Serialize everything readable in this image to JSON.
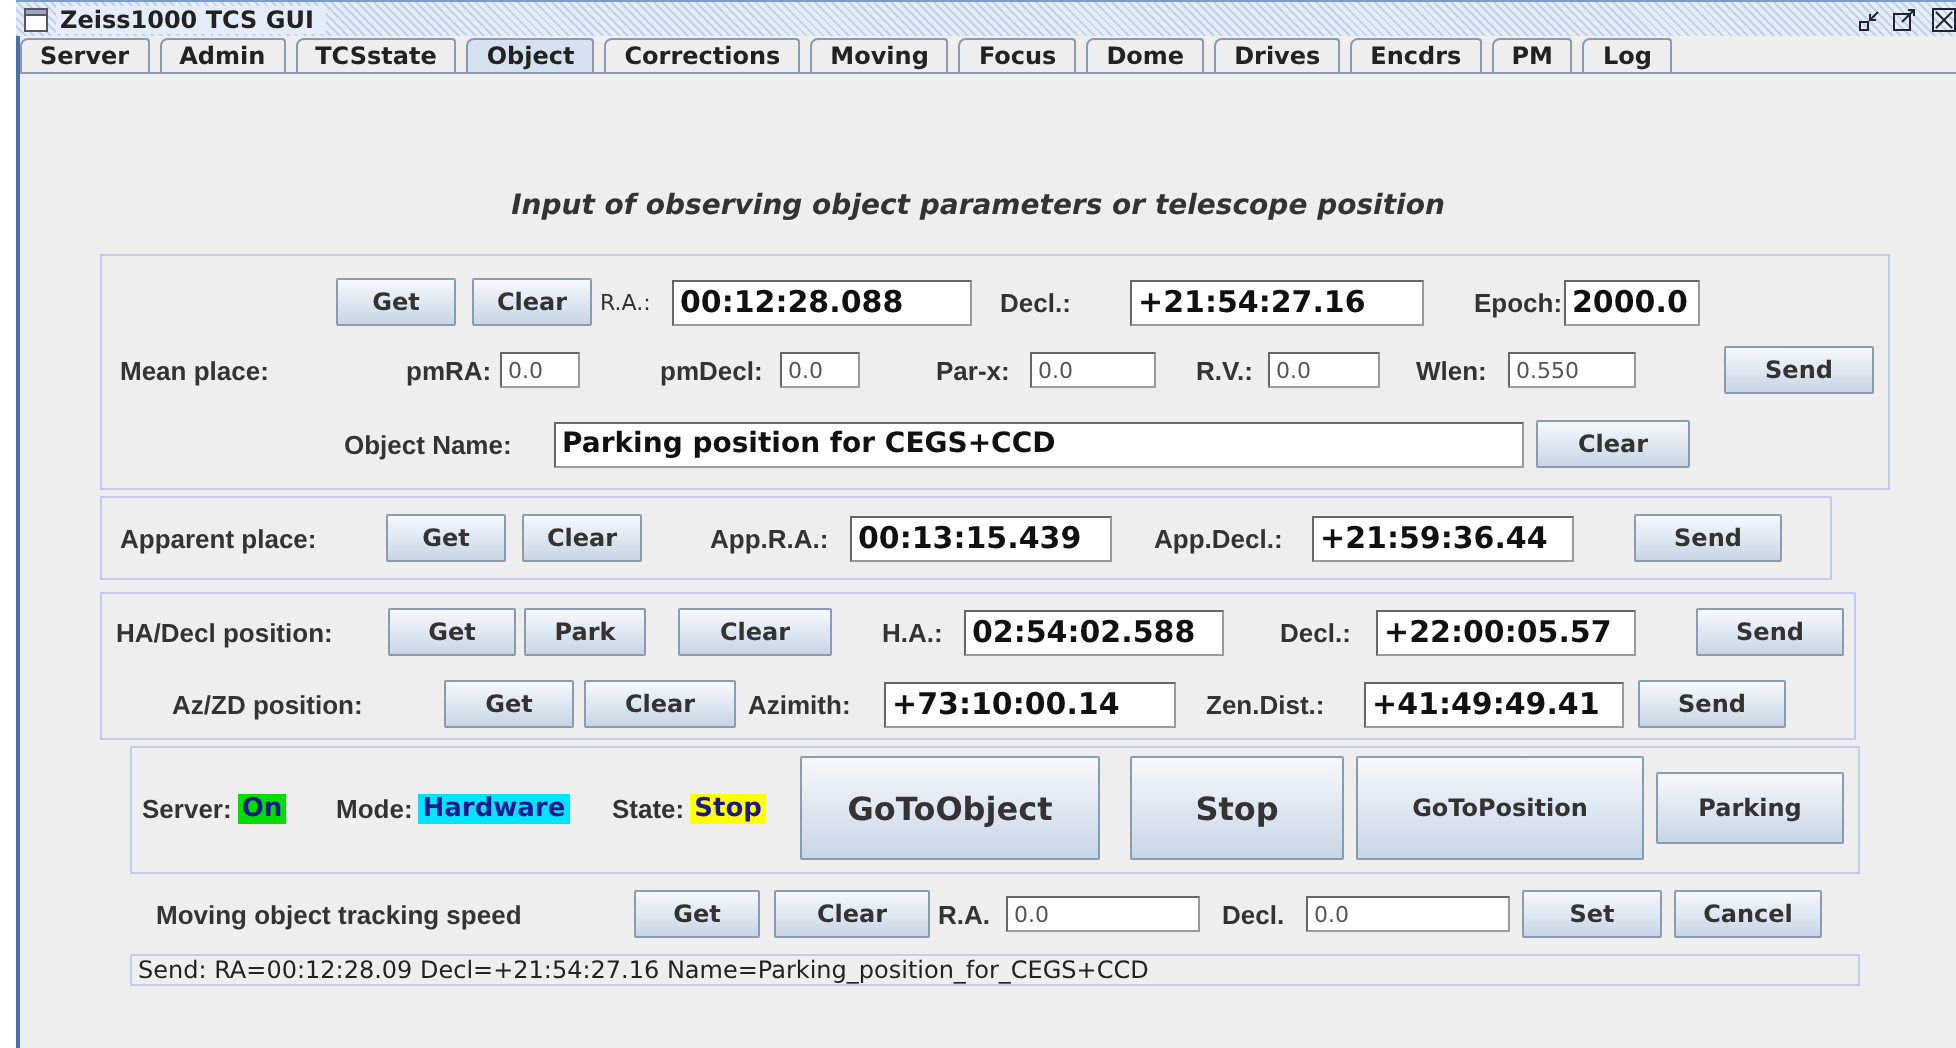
{
  "window": {
    "title": "Zeiss1000 TCS GUI"
  },
  "tabs": [
    {
      "label": "Server",
      "selected": false
    },
    {
      "label": "Admin",
      "selected": false
    },
    {
      "label": "TCSstate",
      "selected": false
    },
    {
      "label": "Object",
      "selected": true
    },
    {
      "label": "Corrections",
      "selected": false
    },
    {
      "label": "Moving",
      "selected": false
    },
    {
      "label": "Focus",
      "selected": false
    },
    {
      "label": "Dome",
      "selected": false
    },
    {
      "label": "Drives",
      "selected": false
    },
    {
      "label": "Encdrs",
      "selected": false
    },
    {
      "label": "PM",
      "selected": false
    },
    {
      "label": "Log",
      "selected": false
    }
  ],
  "heading": "Input of observing object parameters or telescope position",
  "panels": [
    {
      "rows": [
        {
          "items": [
            {
              "kind": "button",
              "text": "Get"
            },
            {
              "kind": "button",
              "text": "Clear"
            },
            {
              "kind": "label",
              "text": "R.A.:"
            },
            {
              "kind": "field",
              "value": "00:12:28.088"
            },
            {
              "kind": "label",
              "text": "Decl.:"
            },
            {
              "kind": "field",
              "value": "+21:54:27.16"
            },
            {
              "kind": "label",
              "text": "Epoch:"
            },
            {
              "kind": "field",
              "value": "2000.0"
            }
          ]
        },
        {
          "items": [
            {
              "kind": "label",
              "text": "Mean place:"
            },
            {
              "kind": "label",
              "text": "pmRA:"
            },
            {
              "kind": "field",
              "value": "0.0"
            },
            {
              "kind": "label",
              "text": "pmDecl:"
            },
            {
              "kind": "field",
              "value": "0.0"
            },
            {
              "kind": "label",
              "text": "Par-x:"
            },
            {
              "kind": "field",
              "value": "0.0"
            },
            {
              "kind": "label",
              "text": "R.V.:"
            },
            {
              "kind": "field",
              "value": "0.0"
            },
            {
              "kind": "label",
              "text": "Wlen:"
            },
            {
              "kind": "field",
              "value": "0.550"
            },
            {
              "kind": "button",
              "text": "Send"
            }
          ]
        },
        {
          "items": [
            {
              "kind": "label",
              "text": "Object Name:"
            },
            {
              "kind": "field",
              "value": "Parking position for CEGS+CCD"
            },
            {
              "kind": "button",
              "text": "Clear"
            }
          ]
        }
      ]
    },
    {
      "rows": [
        {
          "items": [
            {
              "kind": "label",
              "text": "Apparent place:"
            },
            {
              "kind": "button",
              "text": "Get"
            },
            {
              "kind": "button",
              "text": "Clear"
            },
            {
              "kind": "label",
              "text": "App.R.A.:"
            },
            {
              "kind": "field",
              "value": "00:13:15.439"
            },
            {
              "kind": "label",
              "text": "App.Decl.:"
            },
            {
              "kind": "field",
              "value": "+21:59:36.44"
            },
            {
              "kind": "button",
              "text": "Send"
            }
          ]
        }
      ]
    },
    {
      "rows": [
        {
          "items": [
            {
              "kind": "label",
              "text": "HA/Decl position:"
            },
            {
              "kind": "button",
              "text": "Get"
            },
            {
              "kind": "button",
              "text": "Park"
            },
            {
              "kind": "button",
              "text": "Clear"
            },
            {
              "kind": "label",
              "text": "H.A.:"
            },
            {
              "kind": "field",
              "value": "02:54:02.588"
            },
            {
              "kind": "label",
              "text": "Decl.:"
            },
            {
              "kind": "field",
              "value": "+22:00:05.57"
            },
            {
              "kind": "button",
              "text": "Send"
            }
          ]
        },
        {
          "items": [
            {
              "kind": "label",
              "text": "Az/ZD position:"
            },
            {
              "kind": "button",
              "text": "Get"
            },
            {
              "kind": "button",
              "text": "Clear"
            },
            {
              "kind": "label",
              "text": "Azimith:"
            },
            {
              "kind": "field",
              "value": "+73:10:00.14"
            },
            {
              "kind": "label",
              "text": "Zen.Dist.:"
            },
            {
              "kind": "field",
              "value": "+41:49:49.41"
            },
            {
              "kind": "button",
              "text": "Send"
            }
          ]
        }
      ]
    },
    {
      "rows": [
        {
          "items": [
            {
              "kind": "status",
              "label": "Server:",
              "value": "On",
              "color": "#00dd00"
            },
            {
              "kind": "status",
              "label": "Mode:",
              "value": "Hardware",
              "color": "#00e5ff"
            },
            {
              "kind": "status",
              "label": "State:",
              "value": "Stop",
              "color": "#ffff00"
            },
            {
              "kind": "button",
              "text": "GoToObject"
            },
            {
              "kind": "button",
              "text": "Stop"
            },
            {
              "kind": "button",
              "text": "GoToPosition"
            },
            {
              "kind": "button",
              "text": "Parking"
            }
          ]
        }
      ]
    }
  ],
  "tracking": {
    "items": [
      {
        "kind": "label",
        "text": "Moving object tracking speed"
      },
      {
        "kind": "button",
        "text": "Get"
      },
      {
        "kind": "button",
        "text": "Clear"
      },
      {
        "kind": "label",
        "text": "R.A."
      },
      {
        "kind": "field",
        "value": "0.0"
      },
      {
        "kind": "label",
        "text": "Decl."
      },
      {
        "kind": "field",
        "value": "0.0"
      },
      {
        "kind": "button",
        "text": "Set"
      },
      {
        "kind": "button",
        "text": "Cancel"
      }
    ]
  },
  "status_bar": "Send: RA=00:12:28.09 Decl=+21:54:27.16 Name=Parking_position_for_CEGS+CCD"
}
